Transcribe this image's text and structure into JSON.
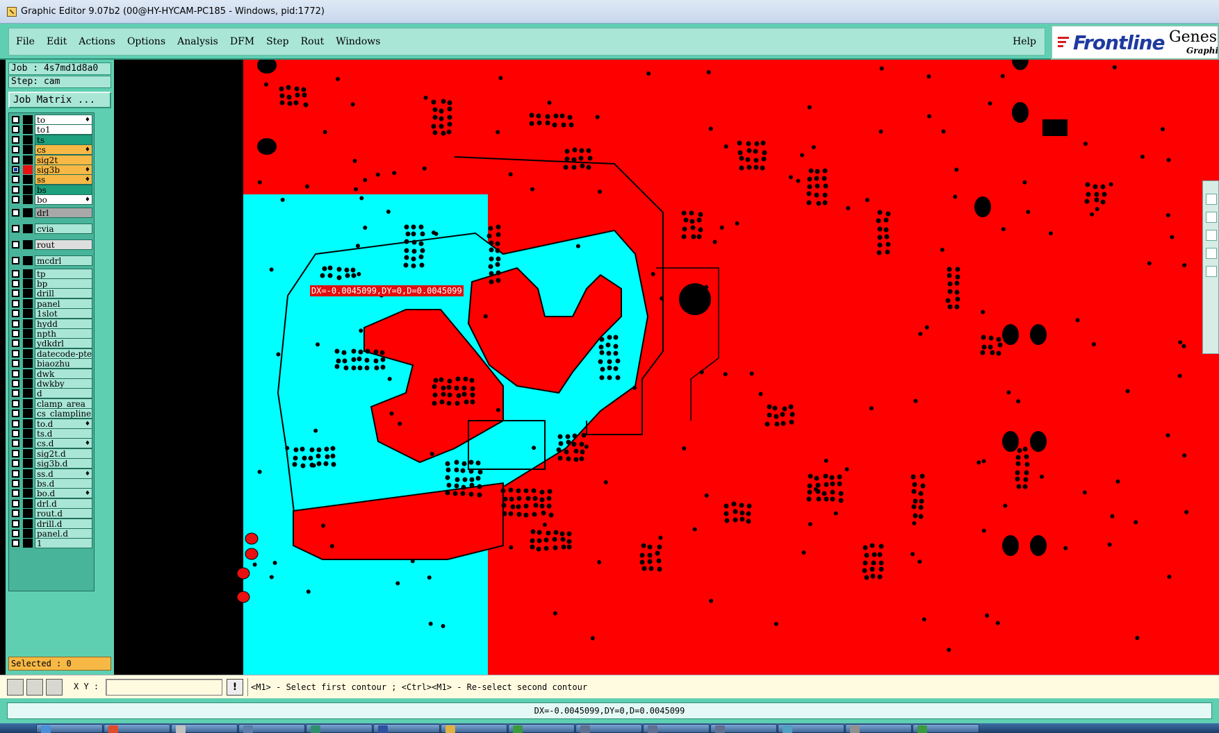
{
  "window": {
    "title": "Graphic Editor 9.07b2 (00@HY-HYCAM-PC185 - Windows, pid:1772)"
  },
  "menu": {
    "items": [
      "File",
      "Edit",
      "Actions",
      "Options",
      "Analysis",
      "DFM",
      "Step",
      "Rout",
      "Windows"
    ],
    "help": "Help"
  },
  "brand": {
    "name": "Frontline",
    "product": "Genesis",
    "sub": "Graphic"
  },
  "panel": {
    "job": "Job : 4s7md1d8a0",
    "step": "Step: cam",
    "job_matrix": "Job Matrix ...",
    "selected": "Selected : 0"
  },
  "layers": [
    {
      "name": "to",
      "color": "#ffffff",
      "lock": true
    },
    {
      "name": "to1",
      "color": "#ffffff",
      "lock": false
    },
    {
      "name": "ts",
      "color": "#1e9f7e",
      "lock": false
    },
    {
      "name": "cs",
      "color": "#f7b845",
      "lock": true
    },
    {
      "name": "sig2t",
      "color": "#f7b845",
      "lock": false
    },
    {
      "name": "sig3b",
      "color": "#f7b845",
      "lock": true,
      "active": true
    },
    {
      "name": "ss",
      "color": "#f7b845",
      "lock": true
    },
    {
      "name": "bs",
      "color": "#1e9f7e",
      "lock": false
    },
    {
      "name": "bo",
      "color": "#ffffff",
      "lock": true
    },
    {
      "name": "drl",
      "color": "#a8a8a8",
      "lock": false,
      "gap": true
    },
    {
      "name": "cvia",
      "color": "#a9e6d6",
      "lock": false,
      "gap": true
    },
    {
      "name": "rout",
      "color": "#dedede",
      "lock": false,
      "gap": true
    },
    {
      "name": "mcdrl",
      "color": "#a9e6d6",
      "lock": false,
      "gap": true
    },
    {
      "name": "tp",
      "color": "#a9e6d6",
      "lock": false
    },
    {
      "name": "bp",
      "color": "#a9e6d6",
      "lock": false
    },
    {
      "name": "drill",
      "color": "#a9e6d6",
      "lock": false
    },
    {
      "name": "panel",
      "color": "#a9e6d6",
      "lock": false
    },
    {
      "name": "1slot",
      "color": "#a9e6d6",
      "lock": false
    },
    {
      "name": "hydd",
      "color": "#a9e6d6",
      "lock": false
    },
    {
      "name": "npth",
      "color": "#a9e6d6",
      "lock": false
    },
    {
      "name": "ydkdrl",
      "color": "#a9e6d6",
      "lock": false
    },
    {
      "name": "datecode-pte",
      "color": "#a9e6d6",
      "lock": false
    },
    {
      "name": "biaozhu",
      "color": "#a9e6d6",
      "lock": false
    },
    {
      "name": "dwk",
      "color": "#a9e6d6",
      "lock": false
    },
    {
      "name": "dwkby",
      "color": "#a9e6d6",
      "lock": false
    },
    {
      "name": "d",
      "color": "#a9e6d6",
      "lock": false
    },
    {
      "name": "clamp_area",
      "color": "#a9e6d6",
      "lock": false
    },
    {
      "name": "cs_clampline",
      "color": "#a9e6d6",
      "lock": false
    },
    {
      "name": "to.d",
      "color": "#a9e6d6",
      "lock": true
    },
    {
      "name": "ts.d",
      "color": "#a9e6d6",
      "lock": false
    },
    {
      "name": "cs.d",
      "color": "#a9e6d6",
      "lock": true
    },
    {
      "name": "sig2t.d",
      "color": "#a9e6d6",
      "lock": false
    },
    {
      "name": "sig3b.d",
      "color": "#a9e6d6",
      "lock": false
    },
    {
      "name": "ss.d",
      "color": "#a9e6d6",
      "lock": true
    },
    {
      "name": "bs.d",
      "color": "#a9e6d6",
      "lock": false
    },
    {
      "name": "bo.d",
      "color": "#a9e6d6",
      "lock": true
    },
    {
      "name": "drl.d",
      "color": "#a9e6d6",
      "lock": false
    },
    {
      "name": "rout.d",
      "color": "#a9e6d6",
      "lock": false
    },
    {
      "name": "drill.d",
      "color": "#a9e6d6",
      "lock": false
    },
    {
      "name": "panel.d",
      "color": "#a9e6d6",
      "lock": false
    },
    {
      "name": "1",
      "color": "#a9e6d6",
      "lock": false
    }
  ],
  "canvas": {
    "measure_label": "DX=-0.0045099,DY=0,D=0.0045099",
    "colors": {
      "copper": "#ff0000",
      "cyan_layer": "#00ffff",
      "background": "#000000"
    }
  },
  "command": {
    "xy_label": "X Y :",
    "xy_value": "",
    "warn_symbol": "!",
    "prompt": "<M1> - Select first contour ; <Ctrl><M1> - Re-select second contour"
  },
  "status": {
    "text": "DX=-0.0045099,DY=0,D=0.0045099"
  },
  "icons": [
    "zoom-to-fit-icon",
    "snap-icon",
    "grid-icon",
    "warning-icon"
  ]
}
